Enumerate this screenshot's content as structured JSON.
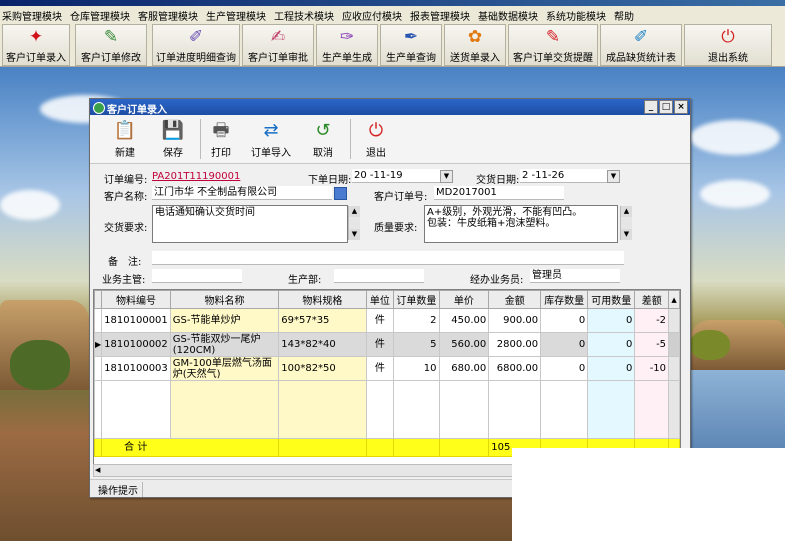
{
  "menubar": [
    "采购管理模块",
    "仓库管理模块",
    "客服管理模块",
    "生产管理模块",
    "工程技术模块",
    "应收应付模块",
    "报表管理模块",
    "基础数据模块",
    "系统功能模块",
    "帮助"
  ],
  "toolbar": [
    {
      "label": "客户订单录入",
      "icon": "pdf-icon",
      "glyph": "✦",
      "color": "#d0121b"
    },
    {
      "label": "客户订单修改",
      "icon": "edit-icon",
      "glyph": "✎",
      "color": "#3b8a3b"
    },
    {
      "label": "订单进度明细查询",
      "icon": "query-icon",
      "glyph": "✐",
      "color": "#6a4db3"
    },
    {
      "label": "客户订单审批",
      "icon": "approve-icon",
      "glyph": "✍",
      "color": "#c13b6a"
    },
    {
      "label": "生产单生成",
      "icon": "generate-icon",
      "glyph": "✑",
      "color": "#8a3fb8"
    },
    {
      "label": "生产单查询",
      "icon": "search-doc-icon",
      "glyph": "✒",
      "color": "#2a55b0"
    },
    {
      "label": "送货单录入",
      "icon": "flower-icon",
      "glyph": "✿",
      "color": "#e07a10"
    },
    {
      "label": "客户订单交货提醒",
      "icon": "reminder-icon",
      "glyph": "✎",
      "color": "#d4232a"
    },
    {
      "label": "成品缺货统计表",
      "icon": "stats-icon",
      "glyph": "✐",
      "color": "#1b7fc4"
    },
    {
      "label": "退出系统",
      "icon": "power-icon",
      "glyph": "⏻",
      "color": "#d41f1f"
    }
  ],
  "window": {
    "title": "客户订单录入",
    "tools": [
      {
        "label": "新建",
        "icon": "new-document-icon",
        "glyph": "📋",
        "color": "#d49a1a"
      },
      {
        "label": "保存",
        "icon": "save-icon",
        "glyph": "💾",
        "color": "#e6a800"
      },
      {
        "label": "打印",
        "icon": "printer-icon",
        "glyph": "🖶",
        "color": "#555"
      },
      {
        "label": "订单导入",
        "icon": "import-icon",
        "glyph": "⇄",
        "color": "#1a6fc4"
      },
      {
        "label": "取消",
        "icon": "cancel-icon",
        "glyph": "↺",
        "color": "#2a8a2a"
      },
      {
        "label": "退出",
        "icon": "exit-icon",
        "glyph": "⏻",
        "color": "#d41f1f"
      }
    ],
    "form": {
      "order_no_label": "订单编号:",
      "order_no": "PA201T11190001",
      "order_date_label": "下单日期:",
      "order_date": "20 -11-19",
      "delivery_date_label": "交货日期:",
      "delivery_date": "2 -11-26",
      "customer_label": "客户名称:",
      "customer": "江门市华 不全制品有限公司",
      "cust_order_label": "客户订单号:",
      "cust_order": "MD2017001",
      "delivery_req_label": "交货要求:",
      "delivery_req": "电话通知确认交货时间",
      "quality_req_label": "质量要求:",
      "quality_req": "A+级别，外观光滑，不能有凹凸。\n包装：牛皮纸箱+泡沫塑料。",
      "remark_label": "备　注:",
      "remark": "",
      "salesman_label": "业务主管:",
      "salesman": "",
      "dept_label": "生产部:",
      "dept": "",
      "handler_label": "经办业务员:",
      "handler": "管理员"
    },
    "grid": {
      "headers": [
        "物料编号",
        "物料名称",
        "物料规格",
        "单位",
        "订单数量",
        "单价",
        "金额",
        "库存数量",
        "可用数量",
        "差额"
      ],
      "rows": [
        {
          "code": "1810100001",
          "name": "GS-节能单炒炉",
          "spec": "69*57*35",
          "unit": "件",
          "qty": "2",
          "price": "450.00",
          "amount": "900.00",
          "stock": "0",
          "avail": "0",
          "diff": "-2"
        },
        {
          "code": "1810100002",
          "name": "GS-节能双炒一尾炉(120CM)",
          "spec": "143*82*40",
          "unit": "件",
          "qty": "5",
          "price": "560.00",
          "amount": "2800.00",
          "stock": "0",
          "avail": "0",
          "diff": "-5"
        },
        {
          "code": "1810100003",
          "name": "GM-100单层燃气汤面炉(天然气)",
          "spec": "100*82*50",
          "unit": "件",
          "qty": "10",
          "price": "680.00",
          "amount": "6800.00",
          "stock": "0",
          "avail": "0",
          "diff": "-10"
        }
      ],
      "total_label": "合 计",
      "total_amount": "105"
    },
    "status": "操作提示"
  }
}
